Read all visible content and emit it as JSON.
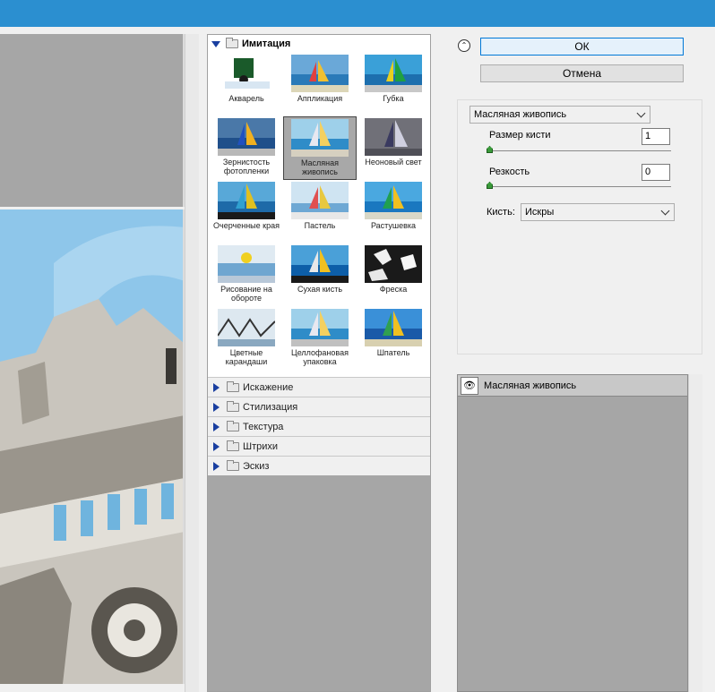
{
  "gallery": {
    "open_category": "Имитация",
    "thumbnails": [
      {
        "label": "Акварель",
        "style": "watercolor"
      },
      {
        "label": "Аппликация",
        "style": "cutout"
      },
      {
        "label": "Губка",
        "style": "sponge"
      },
      {
        "label": "Зернистость фотопленки",
        "style": "grain"
      },
      {
        "label": "Масляная живопись",
        "style": "oil",
        "selected": true
      },
      {
        "label": "Неоновый свет",
        "style": "neon"
      },
      {
        "label": "Очерченные края",
        "style": "edges"
      },
      {
        "label": "Пастель",
        "style": "pastel"
      },
      {
        "label": "Растушевка",
        "style": "smudge"
      },
      {
        "label": "Рисование на обороте",
        "style": "underpaint"
      },
      {
        "label": "Сухая кисть",
        "style": "drybrush"
      },
      {
        "label": "Фреска",
        "style": "fresco"
      },
      {
        "label": "Цветные карандаши",
        "style": "pencil"
      },
      {
        "label": "Целлофановая упаковка",
        "style": "plastic"
      },
      {
        "label": "Шпатель",
        "style": "palette"
      }
    ],
    "closed_categories": [
      "Искажение",
      "Стилизация",
      "Текстура",
      "Штрихи",
      "Эскиз"
    ]
  },
  "buttons": {
    "ok": "ОК",
    "cancel": "Отмена"
  },
  "settings": {
    "filter_select": "Масляная живопись",
    "brush_size_label": "Размер кисти",
    "brush_size_value": "1",
    "sharpness_label": "Резкость",
    "sharpness_value": "0",
    "brush_label": "Кисть:",
    "brush_value": "Искры"
  },
  "layers": {
    "active_layer": "Масляная живопись"
  },
  "colors": {
    "titlebar": "#2b8fd0",
    "sky": "#8ec6ea",
    "panel_gray": "#a6a6a6"
  }
}
